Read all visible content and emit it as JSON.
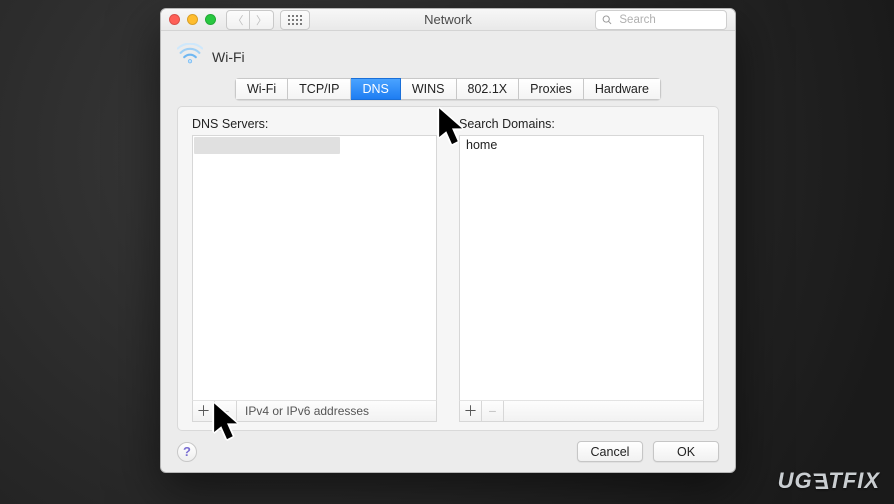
{
  "window": {
    "title": "Network"
  },
  "search": {
    "placeholder": "Search"
  },
  "connection": {
    "name": "Wi-Fi"
  },
  "tabs": {
    "items": [
      "Wi-Fi",
      "TCP/IP",
      "DNS",
      "WINS",
      "802.1X",
      "Proxies",
      "Hardware"
    ],
    "selected": "DNS"
  },
  "dns": {
    "servers_label": "DNS Servers:",
    "addr_hint": "IPv4 or IPv6 addresses",
    "domains_label": "Search Domains:",
    "domains": [
      "home"
    ]
  },
  "buttons": {
    "cancel": "Cancel",
    "ok": "OK",
    "help": "?"
  },
  "watermark": "UGETFIX"
}
